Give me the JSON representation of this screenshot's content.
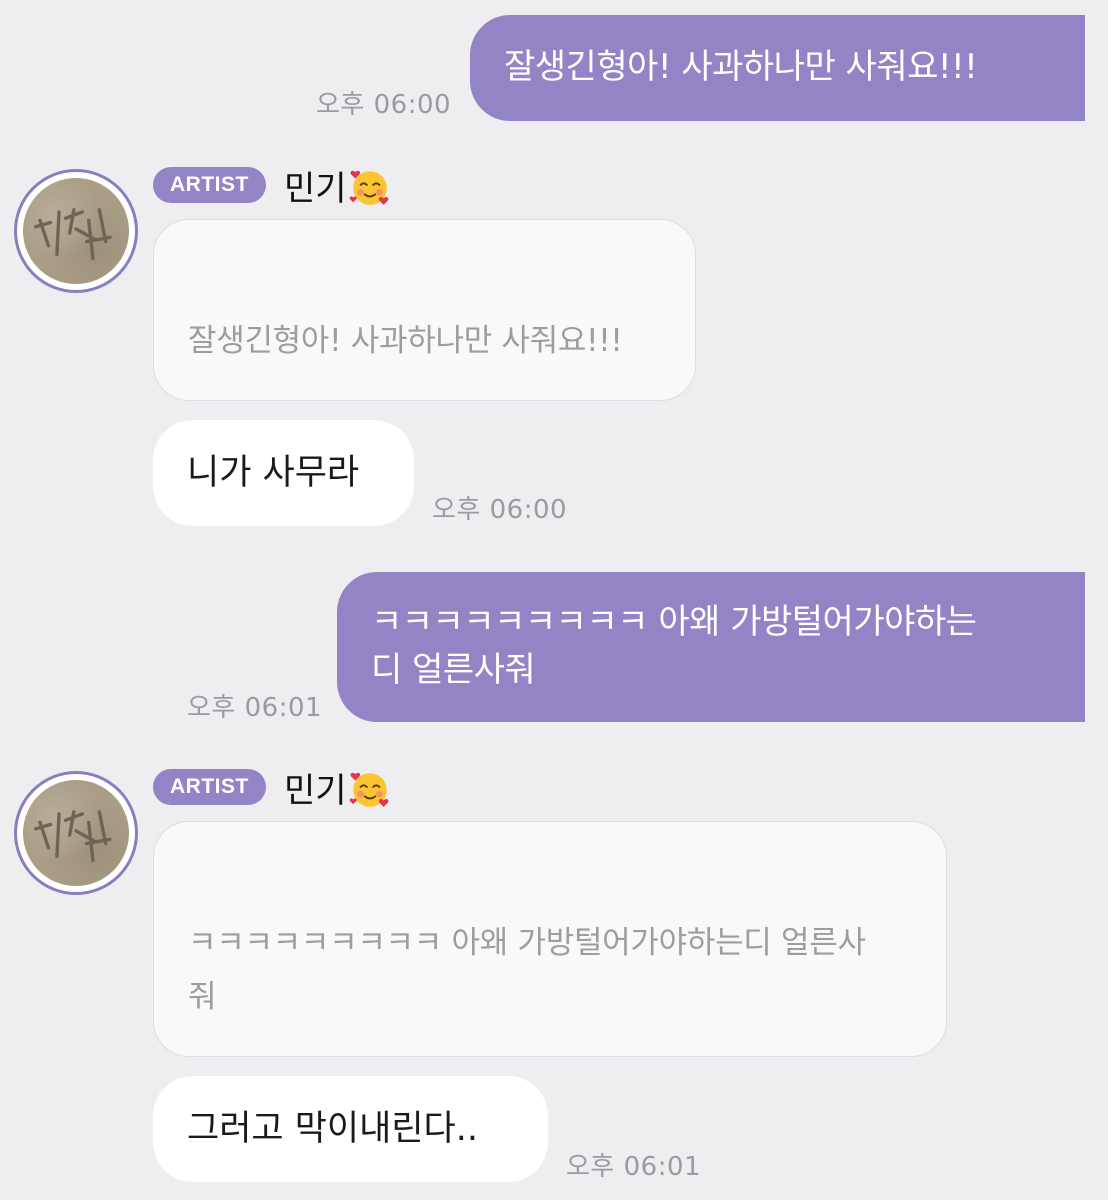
{
  "conversation": [
    {
      "kind": "outgoing",
      "text": "잘생긴형아! 사과하나만 사줘요!!!",
      "time": "오후 06:00"
    },
    {
      "kind": "artist",
      "badge": "ARTIST",
      "name": "민기",
      "name_emoji": "smiling-face-with-hearts-icon",
      "quote": "잘생긴형아! 사과하나만 사줘요!!!",
      "reply": "니가 사무라",
      "time": "오후 06:00"
    },
    {
      "kind": "outgoing",
      "text": "ㅋㅋㅋㅋㅋㅋㅋㅋㅋ 아왜 가방털어가야하는\n디 얼른사줘",
      "time": "오후 06:01"
    },
    {
      "kind": "artist",
      "badge": "ARTIST",
      "name": "민기",
      "name_emoji": "smiling-face-with-hearts-icon",
      "quote": "ㅋㅋㅋㅋㅋㅋㅋㅋㅋ 아왜 가방털어가야하는디 얼른사\n줘",
      "reply": "그러고 막이내린다..",
      "time": "오후 06:01"
    }
  ],
  "colors": {
    "background": "#eeeef0",
    "outgoing_bubble": "#9384c6",
    "badge": "#9384c6",
    "avatar_ring": "#8a7ec0",
    "incoming_bubble": "#ffffff",
    "quote_bubble": "#f9f9fa",
    "timestamp": "#9b9b9f"
  }
}
